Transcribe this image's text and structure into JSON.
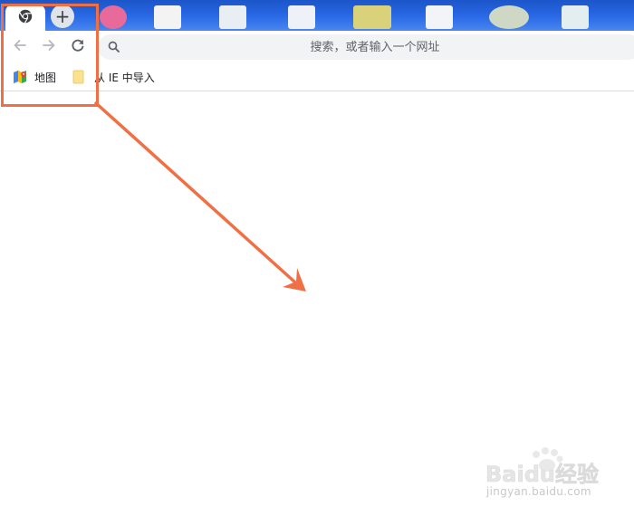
{
  "browser": {
    "new_tab_label": "+"
  },
  "omnibox": {
    "placeholder": "搜索，或者输入一个网址"
  },
  "bookmarks": [
    {
      "label": "地图",
      "icon": "google-maps-icon"
    },
    {
      "label": "从 IE 中导入",
      "icon": "folder-icon"
    }
  ],
  "watermark": {
    "brand": "Baidu经验",
    "url": "jingyan.baidu.com"
  },
  "colors": {
    "annotation": "#f07045",
    "omnibox_bg": "#f1f3f4",
    "desktop_blue": "#2a6ae6"
  }
}
